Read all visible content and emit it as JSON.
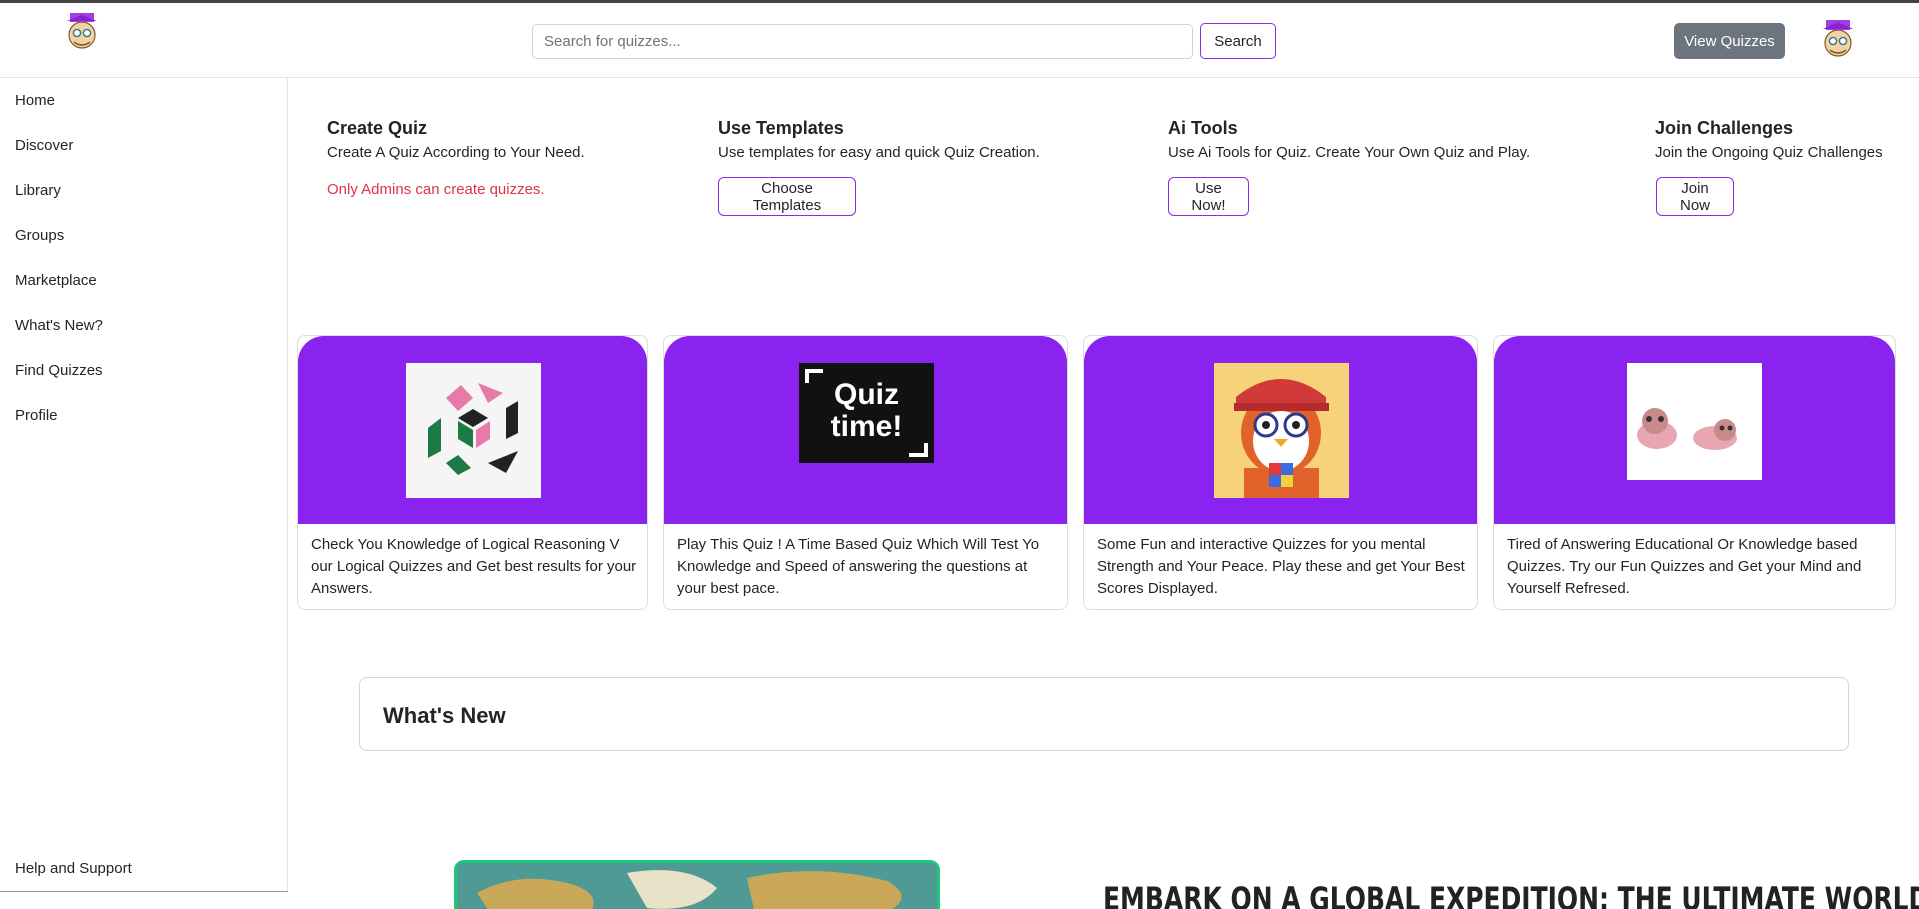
{
  "header": {
    "search_placeholder": "Search for quizzes...",
    "search_button": "Search",
    "view_quizzes_button": "View Quizzes"
  },
  "sidebar": {
    "items": [
      {
        "label": "Home"
      },
      {
        "label": "Discover"
      },
      {
        "label": "Library"
      },
      {
        "label": "Groups"
      },
      {
        "label": "Marketplace"
      },
      {
        "label": "What's New?"
      },
      {
        "label": "Find Quizzes"
      },
      {
        "label": "Profile"
      }
    ],
    "help": "Help and Support"
  },
  "features": {
    "create": {
      "title": "Create Quiz",
      "desc": "Create A Quiz According to Your Need.",
      "warning": "Only Admins can create quizzes."
    },
    "templates": {
      "title": "Use Templates",
      "desc": "Use templates for easy and quick Quiz Creation.",
      "button": "Choose Templates"
    },
    "ai": {
      "title": "Ai Tools",
      "desc": "Use Ai Tools for Quiz. Create Your Own Quiz and Play.",
      "button": "Use Now!"
    },
    "challenges": {
      "title": "Join Challenges",
      "desc": "Join the Ongoing Quiz Challenges",
      "button": "Join Now"
    }
  },
  "cards": [
    {
      "text": "Check You Knowledge of Logical Reasoning V our Logical Quizzes and Get best results for your Answers."
    },
    {
      "text": "Play This Quiz ! A Time Based Quiz Which Will Test Yo Knowledge and Speed of answering the questions at your best pace.",
      "image_text_1": "Quiz",
      "image_text_2": "time!"
    },
    {
      "text": "Some Fun and interactive Quizzes for you mental Strength and Your Peace. Play these and get Your Best Scores Displayed."
    },
    {
      "text": "Tired of Answering Educational Or Knowledge based Quizzes. Try our Fun Quizzes and Get your Mind and Yourself Refresed."
    }
  ],
  "whats_new": {
    "title": "What's New"
  },
  "promo": {
    "heading": "EMBARK ON A GLOBAL EXPEDITION: THE ULTIMATE WORLD"
  },
  "colors": {
    "accent": "#8a22f0",
    "outline": "#8a2be2",
    "warning": "#dc3545",
    "secondary": "#6c757d"
  }
}
